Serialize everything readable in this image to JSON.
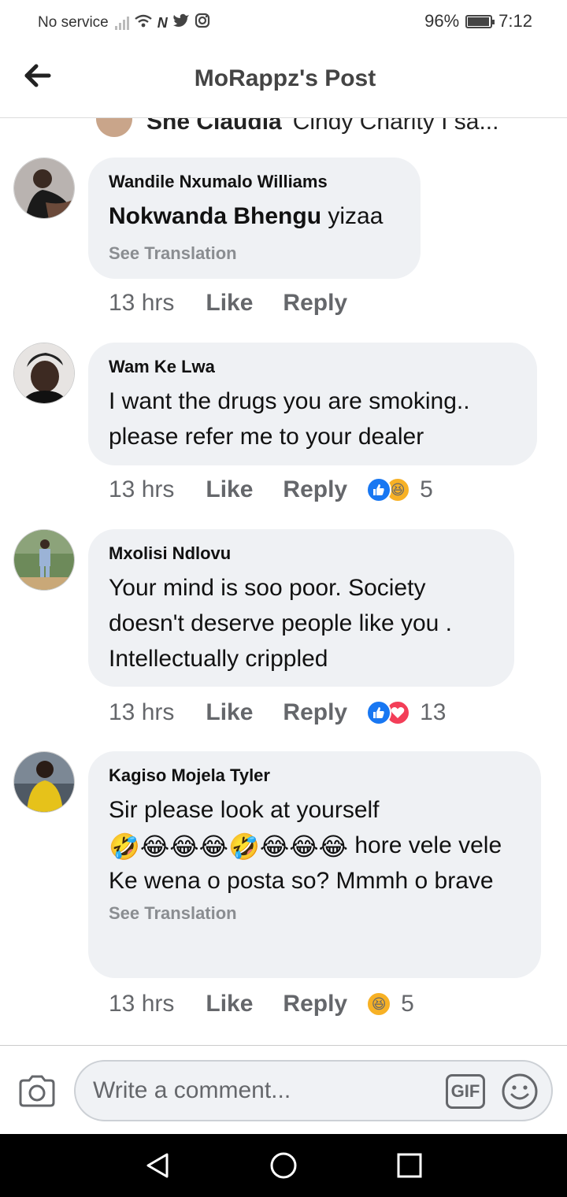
{
  "status_bar": {
    "carrier": "No service",
    "battery": "96%",
    "battery_level": 0.96,
    "time": "7:12"
  },
  "header": {
    "title": "MoRappz's Post",
    "back_icon": "arrow-left-icon"
  },
  "partial_comment": {
    "author": "She Claudia",
    "text": "Cindy Charity I sa..."
  },
  "comments": [
    {
      "author": "Wandile Nxumalo Williams",
      "mention": "Nokwanda Bhengu",
      "text": " yizaa",
      "see_translation": "See Translation",
      "time": "13 hrs",
      "like": "Like",
      "reply": "Reply"
    },
    {
      "author": "Wam Ke Lwa",
      "text": "I want the drugs you are smoking.. please refer me to your dealer",
      "time": "13 hrs",
      "like": "Like",
      "reply": "Reply",
      "reactions": [
        "like",
        "haha"
      ],
      "reaction_count": "5"
    },
    {
      "author": "Mxolisi Ndlovu",
      "text": "Your mind is soo poor. Society doesn't deserve people like you . Intellectually crippled",
      "time": "13 hrs",
      "like": "Like",
      "reply": "Reply",
      "reactions": [
        "like",
        "love"
      ],
      "reaction_count": "13"
    },
    {
      "author": "Kagiso Mojela Tyler",
      "text_line1": "Sir please look at yourself",
      "emojis": "🤣😂😂😂🤣😂😂😂",
      "text_line2": " hore vele vele Ke wena o posta so? Mmmh o brave",
      "see_translation": "See Translation",
      "time": "13 hrs",
      "like": "Like",
      "reply": "Reply",
      "reactions": [
        "haha"
      ],
      "reaction_count": "5"
    }
  ],
  "composer": {
    "placeholder": "Write a comment...",
    "gif_label": "GIF"
  },
  "colors": {
    "bubble": "#eff1f4",
    "meta_text": "#65676b",
    "like_blue": "#1877f2",
    "haha_yellow": "#f7b125",
    "love_red": "#f33e58"
  }
}
